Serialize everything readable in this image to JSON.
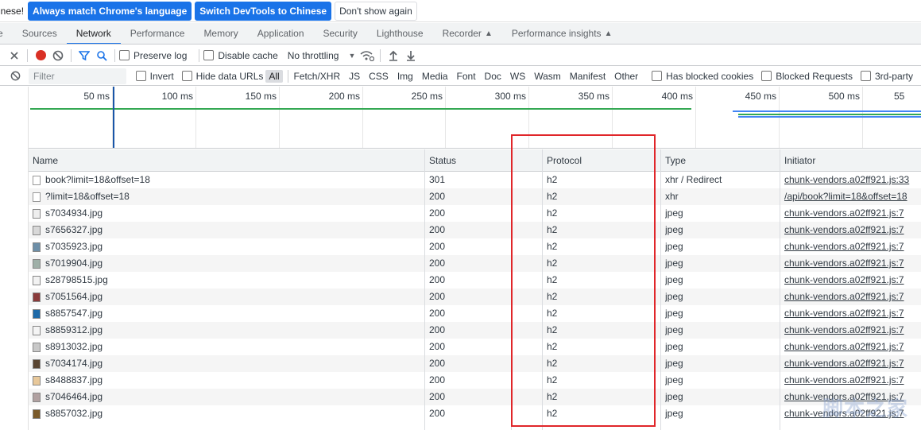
{
  "infobar": {
    "message": "inese!",
    "btn_match": "Always match Chrome's language",
    "btn_switch": "Switch DevTools to Chinese",
    "btn_dismiss": "Don't show again"
  },
  "tabs": [
    "e",
    "Sources",
    "Network",
    "Performance",
    "Memory",
    "Application",
    "Security",
    "Lighthouse",
    "Recorder",
    "Performance insights"
  ],
  "toolbar": {
    "preserve_log": "Preserve log",
    "disable_cache": "Disable cache",
    "throttling": "No throttling"
  },
  "filterbar": {
    "placeholder": "Filter",
    "invert": "Invert",
    "hide_data_urls": "Hide data URLs",
    "types": [
      "All",
      "Fetch/XHR",
      "JS",
      "CSS",
      "Img",
      "Media",
      "Font",
      "Doc",
      "WS",
      "Wasm",
      "Manifest",
      "Other"
    ],
    "has_blocked_cookies": "Has blocked cookies",
    "blocked_requests": "Blocked Requests",
    "third_party": "3rd-party"
  },
  "overview": {
    "ticks": [
      "50 ms",
      "100 ms",
      "150 ms",
      "200 ms",
      "250 ms",
      "300 ms",
      "350 ms",
      "400 ms",
      "450 ms",
      "500 ms",
      "55"
    ]
  },
  "table": {
    "headers": {
      "name": "Name",
      "status": "Status",
      "protocol": "Protocol",
      "type": "Type",
      "initiator": "Initiator"
    },
    "rows": [
      {
        "name": "book?limit=18&offset=18",
        "status": "301",
        "protocol": "h2",
        "type": "xhr / Redirect",
        "initiator": "chunk-vendors.a02ff921.js:33",
        "icon": "doc",
        "color": "#ffffff"
      },
      {
        "name": "?limit=18&offset=18",
        "status": "200",
        "protocol": "h2",
        "type": "xhr",
        "initiator": "/api/book?limit=18&offset=18",
        "icon": "doc",
        "color": "#ffffff"
      },
      {
        "name": "s7034934.jpg",
        "status": "200",
        "protocol": "h2",
        "type": "jpeg",
        "initiator": "chunk-vendors.a02ff921.js:7",
        "icon": "img",
        "color": "#eeeeee"
      },
      {
        "name": "s7656327.jpg",
        "status": "200",
        "protocol": "h2",
        "type": "jpeg",
        "initiator": "chunk-vendors.a02ff921.js:7",
        "icon": "img",
        "color": "#d8d8d8"
      },
      {
        "name": "s7035923.jpg",
        "status": "200",
        "protocol": "h2",
        "type": "jpeg",
        "initiator": "chunk-vendors.a02ff921.js:7",
        "icon": "img",
        "color": "#6d8fa8"
      },
      {
        "name": "s7019904.jpg",
        "status": "200",
        "protocol": "h2",
        "type": "jpeg",
        "initiator": "chunk-vendors.a02ff921.js:7",
        "icon": "img",
        "color": "#9fb0a8"
      },
      {
        "name": "s28798515.jpg",
        "status": "200",
        "protocol": "h2",
        "type": "jpeg",
        "initiator": "chunk-vendors.a02ff921.js:7",
        "icon": "img",
        "color": "#f2f2f2"
      },
      {
        "name": "s7051564.jpg",
        "status": "200",
        "protocol": "h2",
        "type": "jpeg",
        "initiator": "chunk-vendors.a02ff921.js:7",
        "icon": "img",
        "color": "#8a3a3a"
      },
      {
        "name": "s8857547.jpg",
        "status": "200",
        "protocol": "h2",
        "type": "jpeg",
        "initiator": "chunk-vendors.a02ff921.js:7",
        "icon": "img",
        "color": "#1e6aa8"
      },
      {
        "name": "s8859312.jpg",
        "status": "200",
        "protocol": "h2",
        "type": "jpeg",
        "initiator": "chunk-vendors.a02ff921.js:7",
        "icon": "img",
        "color": "#f4f4f4"
      },
      {
        "name": "s8913032.jpg",
        "status": "200",
        "protocol": "h2",
        "type": "jpeg",
        "initiator": "chunk-vendors.a02ff921.js:7",
        "icon": "img",
        "color": "#c8c8c8"
      },
      {
        "name": "s7034174.jpg",
        "status": "200",
        "protocol": "h2",
        "type": "jpeg",
        "initiator": "chunk-vendors.a02ff921.js:7",
        "icon": "img",
        "color": "#5a4632"
      },
      {
        "name": "s8488837.jpg",
        "status": "200",
        "protocol": "h2",
        "type": "jpeg",
        "initiator": "chunk-vendors.a02ff921.js:7",
        "icon": "img",
        "color": "#e8c89a"
      },
      {
        "name": "s7046464.jpg",
        "status": "200",
        "protocol": "h2",
        "type": "jpeg",
        "initiator": "chunk-vendors.a02ff921.js:7",
        "icon": "img",
        "color": "#b0a0a0"
      },
      {
        "name": "s8857032.jpg",
        "status": "200",
        "protocol": "h2",
        "type": "jpeg",
        "initiator": "chunk-vendors.a02ff921.js:7",
        "icon": "img",
        "color": "#7a5a2a"
      }
    ]
  },
  "watermark": "脚本之家",
  "colors": {
    "accent": "#1a73e8",
    "record": "#d93025",
    "highlight": "#e0262a",
    "timeline_green": "#34a853"
  }
}
